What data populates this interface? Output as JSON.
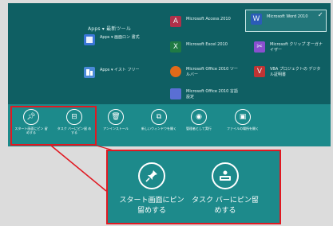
{
  "start_screen": {
    "group_title": "Apps ▾ 最新ツール",
    "tiles": [
      {
        "label": "Apps ▾ 画面ロン 書式",
        "icon": "app-icon",
        "color": "#3a76d6"
      },
      {
        "label": "Apps ▾ イスト フリー",
        "icon": "app-icon",
        "color": "#4a8ad8"
      },
      {
        "label": "Microsoft Access 2010",
        "icon": "access-icon",
        "color": "#b0304a"
      },
      {
        "label": "Microsoft Excel 2010",
        "icon": "excel-icon",
        "color": "#1f7a44"
      },
      {
        "label": "Microsoft Office 2010 ツールバー",
        "icon": "office-icon",
        "color": "#e06a1a"
      },
      {
        "label": "Microsoft Office 2010 言語設定",
        "icon": "office-icon",
        "color": "#5a6fd4"
      },
      {
        "label": "Microsoft Word 2010",
        "icon": "word-icon",
        "color": "#2b5cb8"
      },
      {
        "label": "Microsoft クリップ オーガナイザー",
        "icon": "clip-icon",
        "color": "#8a4fcf"
      },
      {
        "label": "VBA プロジェクトの デジタル証明書",
        "icon": "vba-icon",
        "color": "#c03434"
      }
    ]
  },
  "app_bar": {
    "buttons": [
      {
        "label": "スタート画面にピン 留めする",
        "icon": "pin-icon"
      },
      {
        "label": "タスク バーにピン留 めする",
        "icon": "taskbar-pin-icon"
      },
      {
        "label": "アンインストール",
        "icon": "uninstall-icon"
      },
      {
        "label": "新しいウィンドウを開く",
        "icon": "new-window-icon"
      },
      {
        "label": "管理者として実行",
        "icon": "run-as-admin-icon"
      },
      {
        "label": "ファイルの場所を開く",
        "icon": "open-location-icon"
      }
    ]
  },
  "zoom_callout": {
    "buttons": [
      {
        "label": "スタート画面にピン 留めする",
        "icon": "pin-icon"
      },
      {
        "label": "タスク バーにピン留 めする",
        "icon": "taskbar-pin-icon"
      }
    ]
  },
  "colors": {
    "screen_bg": "#0f5f63",
    "app_bar_bg": "#1c8a8b",
    "highlight": "#e01922"
  }
}
